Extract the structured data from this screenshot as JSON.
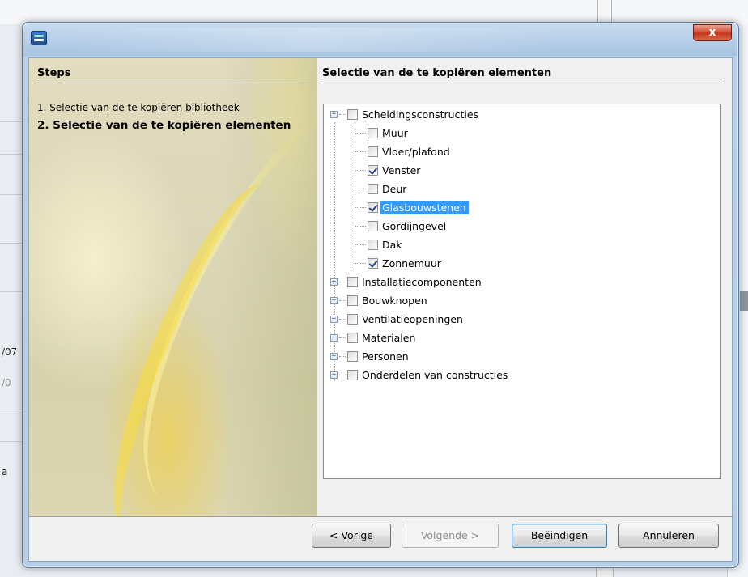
{
  "background": {
    "fragments": [
      "/07",
      "/0",
      "a"
    ]
  },
  "window": {
    "close_label": "x"
  },
  "steps": {
    "header": "Steps",
    "items": [
      {
        "label": "1. Selectie van de te kopiëren bibliotheek",
        "current": false
      },
      {
        "label": "2. Selectie van de te kopiëren elementen",
        "current": true
      }
    ]
  },
  "content": {
    "header": "Selectie van de te kopiëren elementen",
    "tree": {
      "root": {
        "label": "Scheidingsconstructies",
        "checked": false,
        "expanded": true
      },
      "children": [
        {
          "label": "Muur",
          "checked": false
        },
        {
          "label": "Vloer/plafond",
          "checked": false
        },
        {
          "label": "Venster",
          "checked": true
        },
        {
          "label": "Deur",
          "checked": false
        },
        {
          "label": "Glasbouwstenen",
          "checked": true,
          "selected": true
        },
        {
          "label": "Gordijngevel",
          "checked": false
        },
        {
          "label": "Dak",
          "checked": false
        },
        {
          "label": "Zonnemuur",
          "checked": true
        }
      ],
      "collapsed": [
        {
          "label": "Installatiecomponenten",
          "checked": false
        },
        {
          "label": "Bouwknopen",
          "checked": false
        },
        {
          "label": "Ventilatieopeningen",
          "checked": false
        },
        {
          "label": "Materialen",
          "checked": false
        },
        {
          "label": "Personen",
          "checked": false
        },
        {
          "label": "Onderdelen van constructies",
          "checked": false
        }
      ]
    }
  },
  "buttons": {
    "previous": "< Vorige",
    "next": "Volgende >",
    "finish": "Beëindigen",
    "cancel": "Annuleren"
  },
  "colors": {
    "selection": "#3399ff",
    "checkmark": "#2a3f8a",
    "close_button": "#c2351b"
  }
}
